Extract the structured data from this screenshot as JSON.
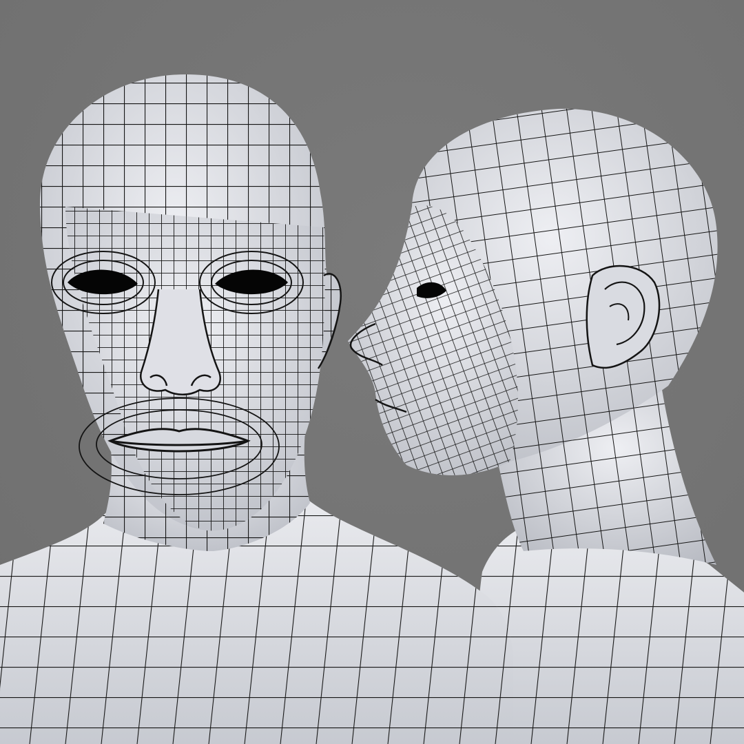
{
  "scene": {
    "background_color": "#6f6f6f",
    "background_light": "#7a7a7a",
    "surface_color": "#e6e7ec",
    "surface_shade": "#b9bcc4",
    "wire_color": "#141414",
    "eye_color": "#050505"
  },
  "models": [
    {
      "id": "front-head-model",
      "view": "front"
    },
    {
      "id": "profile-head-model",
      "view": "profile-left"
    }
  ]
}
